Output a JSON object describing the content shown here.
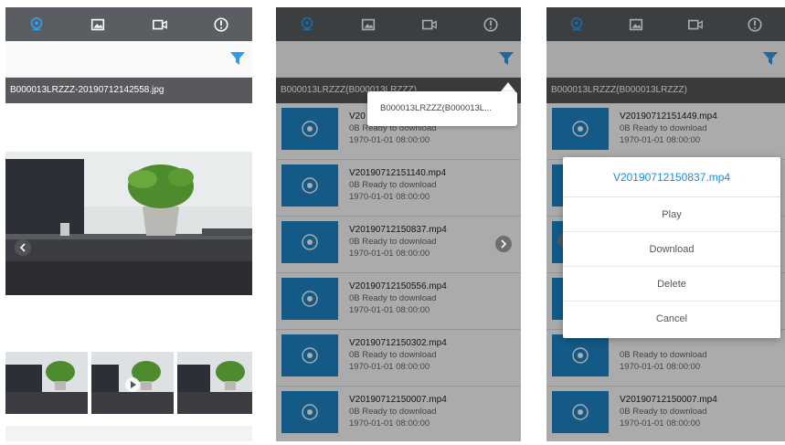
{
  "colors": {
    "topbar": "#5a5e63",
    "active_tab": "#2f9be8",
    "namebar": "#58595c",
    "thumb_blue": "#1f86c9",
    "dialog_title": "#1e8bd4"
  },
  "tabs": [
    {
      "icon": "camera-icon",
      "active": true
    },
    {
      "icon": "image-icon",
      "active": false
    },
    {
      "icon": "video-icon",
      "active": false
    },
    {
      "icon": "info-icon",
      "active": false
    }
  ],
  "screen1": {
    "filename": "B000013LRZZZ-20190712142558.jpg"
  },
  "screen2": {
    "device_label": "B000013LRZZZ(B000013LRZZZ)",
    "popup_text": "B000013LRZZZ(B000013L...",
    "files": [
      {
        "name": "V20",
        "size": "0B  Ready to download",
        "date": "1970-01-01 08:00:00"
      },
      {
        "name": "V20190712151140.mp4",
        "size": "0B  Ready to download",
        "date": "1970-01-01 08:00:00"
      },
      {
        "name": "V20190712150837.mp4",
        "size": "0B  Ready to download",
        "date": "1970-01-01 08:00:00"
      },
      {
        "name": "V20190712150556.mp4",
        "size": "0B  Ready to download",
        "date": "1970-01-01 08:00:00"
      },
      {
        "name": "V20190712150302.mp4",
        "size": "0B  Ready to download",
        "date": "1970-01-01 08:00:00"
      },
      {
        "name": "V20190712150007.mp4",
        "size": "0B  Ready to download",
        "date": "1970-01-01 08:00:00"
      }
    ]
  },
  "screen3": {
    "device_label": "B000013LRZZZ(B000013LRZZZ)",
    "files": [
      {
        "name": "V20190712151449.mp4",
        "size": "0B  Ready to download",
        "date": "1970-01-01 08:00:00"
      },
      {
        "name": "",
        "size": "",
        "date": ""
      },
      {
        "name": "",
        "size": "",
        "date": ""
      },
      {
        "name": "",
        "size": "",
        "date": ""
      },
      {
        "name": "",
        "size": "0B  Ready to download",
        "date": "1970-01-01 08:00:00"
      },
      {
        "name": "V20190712150007.mp4",
        "size": "0B  Ready to download",
        "date": "1970-01-01 08:00:00"
      }
    ],
    "dialog": {
      "title": "V20190712150837.mp4",
      "play": "Play",
      "download": "Download",
      "delete": "Delete",
      "cancel": "Cancel"
    }
  }
}
